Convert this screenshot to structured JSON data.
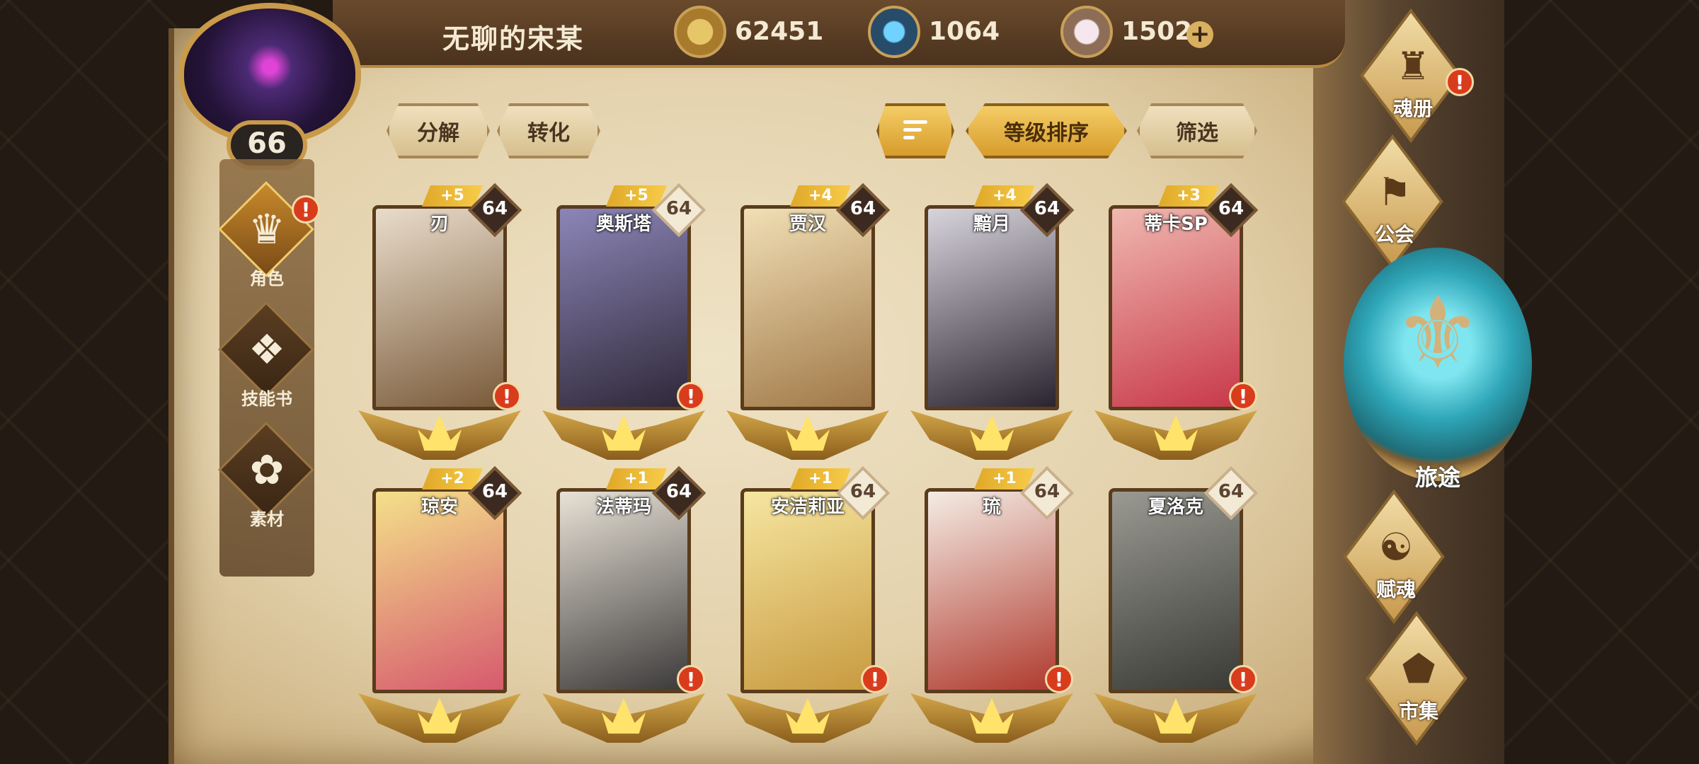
{
  "player": {
    "name": "无聊的宋某",
    "level": "66"
  },
  "currencies": [
    {
      "name": "gold",
      "value": "62451",
      "icon": "gold-coin-icon"
    },
    {
      "name": "gem",
      "value": "1064",
      "icon": "blue-crystal-icon"
    },
    {
      "name": "crystal",
      "value": "1502",
      "icon": "pink-crystal-icon"
    }
  ],
  "add_label": "+",
  "alert_mark": "!",
  "left_nav": [
    {
      "label": "角色",
      "icon": "hero-icon",
      "glyph": "♛",
      "active": true,
      "alert": true
    },
    {
      "label": "技能书",
      "icon": "skill-book-icon",
      "glyph": "❖",
      "active": false,
      "alert": false
    },
    {
      "label": "素材",
      "icon": "material-icon",
      "glyph": "✿",
      "active": false,
      "alert": false
    }
  ],
  "toolbar": {
    "decompose": "分解",
    "convert": "转化",
    "sort_by_level": "等级排序",
    "filter": "筛选"
  },
  "heroes": [
    {
      "name": "刃",
      "plus": "+5",
      "level": "64",
      "alert": true,
      "light_badge": false,
      "colors": [
        "#e9dccb",
        "#7a5b3a"
      ]
    },
    {
      "name": "奥斯塔",
      "plus": "+5",
      "level": "64",
      "alert": true,
      "light_badge": true,
      "colors": [
        "#8c86b8",
        "#2f2838"
      ]
    },
    {
      "name": "贾汉",
      "plus": "+4",
      "level": "64",
      "alert": false,
      "light_badge": false,
      "colors": [
        "#f1dfb5",
        "#a07848"
      ]
    },
    {
      "name": "黯月",
      "plus": "+4",
      "level": "64",
      "alert": false,
      "light_badge": false,
      "colors": [
        "#d8d4dc",
        "#2a2430"
      ]
    },
    {
      "name": "蒂卡SP",
      "plus": "+3",
      "level": "64",
      "alert": true,
      "light_badge": false,
      "colors": [
        "#f0b8b0",
        "#c8394a"
      ]
    },
    {
      "name": "琼安",
      "plus": "+2",
      "level": "64",
      "alert": false,
      "light_badge": false,
      "colors": [
        "#f4e08a",
        "#d65a6e"
      ]
    },
    {
      "name": "法蒂玛",
      "plus": "+1",
      "level": "64",
      "alert": true,
      "light_badge": false,
      "colors": [
        "#e8e2d6",
        "#3c3a3a"
      ]
    },
    {
      "name": "安洁莉亚",
      "plus": "+1",
      "level": "64",
      "alert": true,
      "light_badge": true,
      "colors": [
        "#f6e6a0",
        "#c89a40"
      ]
    },
    {
      "name": "琉",
      "plus": "+1",
      "level": "64",
      "alert": true,
      "light_badge": true,
      "colors": [
        "#f4ece4",
        "#b03a2e"
      ]
    },
    {
      "name": "夏洛克",
      "plus": "",
      "level": "64",
      "alert": true,
      "light_badge": true,
      "colors": [
        "#9a9a92",
        "#3a3a36"
      ]
    }
  ],
  "right_nav": [
    {
      "label": "魂册",
      "icon": "soul-book-icon",
      "glyph": "♜",
      "alert": true
    },
    {
      "label": "公会",
      "icon": "guild-banner-icon",
      "glyph": "⚑",
      "alert": false
    },
    {
      "label": "旅途",
      "icon": "journey-emblem-icon",
      "glyph": "⚜",
      "alert": false
    },
    {
      "label": "赋魂",
      "icon": "soul-flame-icon",
      "glyph": "☯",
      "alert": false
    },
    {
      "label": "市集",
      "icon": "market-gem-icon",
      "glyph": "⬟",
      "alert": false
    }
  ]
}
